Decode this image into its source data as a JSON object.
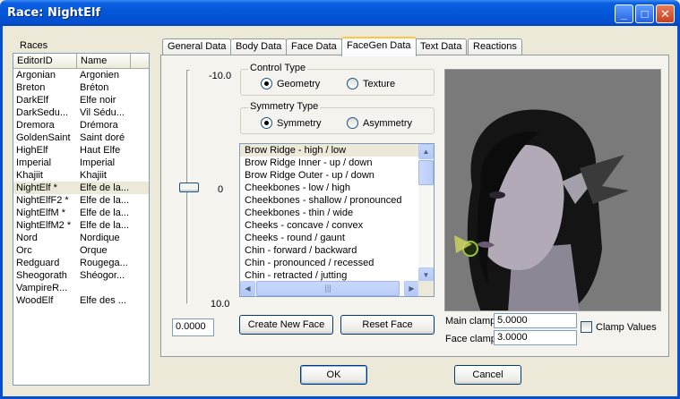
{
  "window": {
    "title": "Race: NightElf",
    "minimize": "_",
    "maximize": "□",
    "close": "✕"
  },
  "races": {
    "label": "Races",
    "columns": [
      "EditorID",
      "Name"
    ],
    "rows": [
      {
        "id": "Argonian",
        "name": "Argonien"
      },
      {
        "id": "Breton",
        "name": "Bréton"
      },
      {
        "id": "DarkElf",
        "name": "Elfe noir"
      },
      {
        "id": "DarkSedu...",
        "name": "Vil Sédu..."
      },
      {
        "id": "Dremora",
        "name": "Drémora"
      },
      {
        "id": "GoldenSaint",
        "name": "Saint doré"
      },
      {
        "id": "HighElf",
        "name": "Haut Elfe"
      },
      {
        "id": "Imperial",
        "name": "Imperial"
      },
      {
        "id": "Khajiit",
        "name": "Khajiit"
      },
      {
        "id": "NightElf *",
        "name": "Elfe de la..."
      },
      {
        "id": "NightElfF2 *",
        "name": "Elfe de la..."
      },
      {
        "id": "NightElfM *",
        "name": "Elfe de la..."
      },
      {
        "id": "NightElfM2 *",
        "name": "Elfe de la..."
      },
      {
        "id": "Nord",
        "name": "Nordique"
      },
      {
        "id": "Orc",
        "name": "Orque"
      },
      {
        "id": "Redguard",
        "name": "Rougega..."
      },
      {
        "id": "Sheogorath",
        "name": "Shéogor..."
      },
      {
        "id": "VampireR...",
        "name": ""
      },
      {
        "id": "WoodElf",
        "name": "Elfe des ..."
      }
    ],
    "selected_index": 9
  },
  "tabs": [
    "General Data",
    "Body Data",
    "Face Data",
    "FaceGen Data",
    "Text Data",
    "Reactions"
  ],
  "active_tab": 3,
  "slider": {
    "top_label": "-10.0",
    "mid_label": "0",
    "bottom_label": "10.0",
    "value": "0.0000",
    "position": 0.5
  },
  "control_type": {
    "title": "Control Type",
    "option1": "Geometry",
    "option2": "Texture",
    "selected": "Geometry"
  },
  "symmetry_type": {
    "title": "Symmetry Type",
    "option1": "Symmetry",
    "option2": "Asymmetry",
    "selected": "Symmetry"
  },
  "features": {
    "items": [
      "Brow Ridge - high / low",
      "Brow Ridge Inner - up / down",
      "Brow Ridge Outer - up / down",
      "Cheekbones - low / high",
      "Cheekbones - shallow / pronounced",
      "Cheekbones - thin / wide",
      "Cheeks - concave / convex",
      "Cheeks - round / gaunt",
      "Chin - forward / backward",
      "Chin - pronounced / recessed",
      "Chin - retracted / jutting",
      "Chin - shallow / deep"
    ],
    "selected_index": 0,
    "hscroll_grip": "|||"
  },
  "buttons": {
    "create_new_face": "Create New Face",
    "reset_face": "Reset Face",
    "ok": "OK",
    "cancel": "Cancel"
  },
  "clamps": {
    "main_label": "Main clamp",
    "main_value": "5.0000",
    "face_label": "Face clamp",
    "face_value": "3.0000",
    "checkbox_label": "Clamp Values"
  }
}
